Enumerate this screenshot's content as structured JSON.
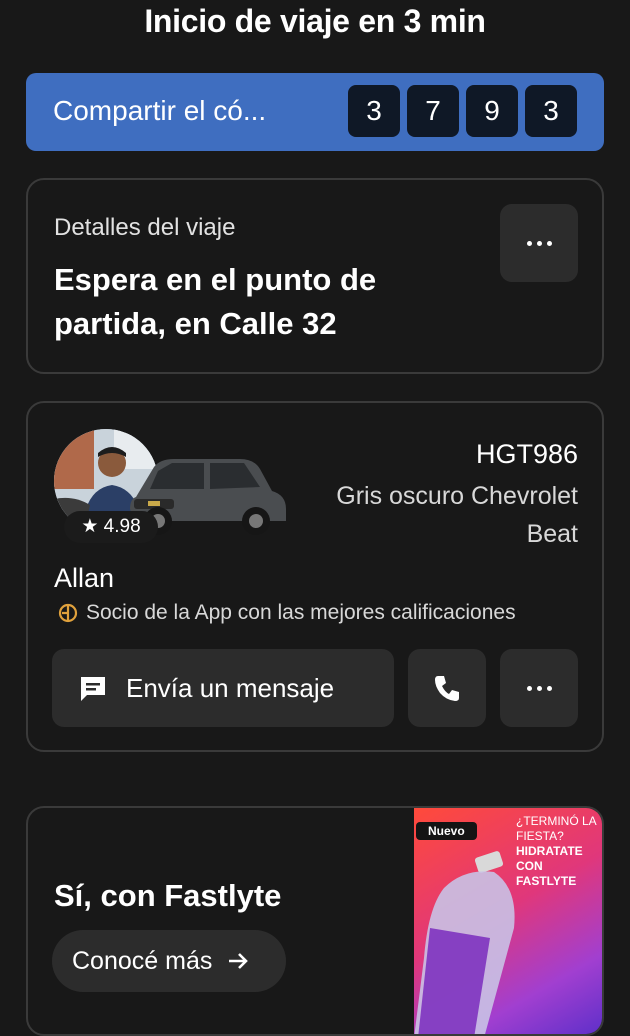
{
  "header": {
    "title": "Inicio de viaje en 3 min"
  },
  "share": {
    "label": "Compartir el có...",
    "code": [
      "3",
      "7",
      "9",
      "3"
    ]
  },
  "trip": {
    "label": "Detalles del viaje",
    "title": "Espera en el punto de partida, en Calle 32"
  },
  "driver": {
    "rating": "★ 4.98",
    "plate": "HGT986",
    "car_model": "Gris oscuro Chevrolet Beat",
    "name": "Allan",
    "badge": "Socio de la App con las mejores calificaciones",
    "message_button": "Envía un mensaje"
  },
  "promo": {
    "title": "Sí, con Fastlyte",
    "button": "Conocé más",
    "tag": "Nuevo",
    "ad_question": "¿TERMINÓ LA FIESTA?",
    "ad_text": "HIDRATATE CON FASTLYTE"
  },
  "colors": {
    "background": "#181818",
    "share_bar": "#3f6ec0",
    "code_box": "#0f1826",
    "button": "#2c2c2c",
    "badge_accent": "#e0a13c"
  },
  "icons": {
    "message": "message-icon",
    "phone": "phone-icon",
    "more": "more-dots-icon",
    "arrow": "arrow-right-icon",
    "badge": "badge-icon"
  }
}
